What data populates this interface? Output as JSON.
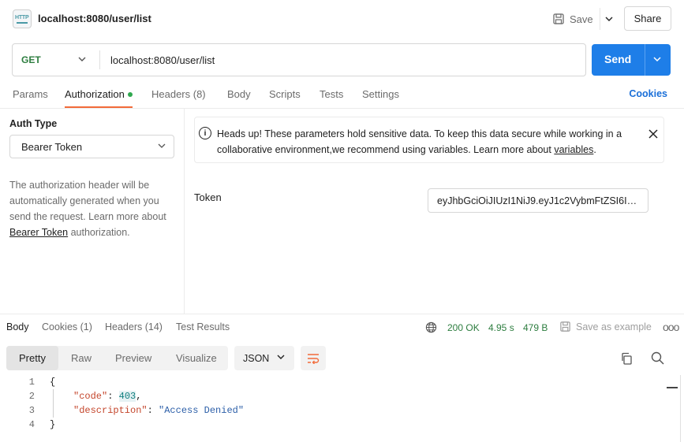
{
  "header": {
    "badge_text": "HTTP",
    "title": "localhost:8080/user/list",
    "save_label": "Save",
    "share_label": "Share"
  },
  "request": {
    "method": "GET",
    "url": "localhost:8080/user/list",
    "send_label": "Send"
  },
  "tabs": [
    {
      "label": "Params"
    },
    {
      "label": "Authorization",
      "active": true,
      "indicator": "green-dot"
    },
    {
      "label": "Headers (8)"
    },
    {
      "label": "Body"
    },
    {
      "label": "Scripts"
    },
    {
      "label": "Tests"
    },
    {
      "label": "Settings"
    }
  ],
  "cookies_label": "Cookies",
  "auth": {
    "type_label": "Auth Type",
    "type_value": "Bearer Token",
    "desc_prefix": "The authorization header will be automatically generated when you send the request. Learn more about ",
    "desc_link": "Bearer Token",
    "desc_suffix": " authorization.",
    "notice_prefix": "Heads up! These parameters hold sensitive data. To keep this data secure while working in a collaborative environment,we recommend using variables. Learn more about ",
    "notice_link": "variables",
    "notice_suffix": ".",
    "token_label": "Token",
    "token_value": "eyJhbGciOiJIUzI1NiJ9.eyJ1c2VybmFtZSI6In..."
  },
  "response": {
    "tabs": [
      {
        "label": "Body",
        "active": true
      },
      {
        "label": "Cookies (1)"
      },
      {
        "label": "Headers (14)"
      },
      {
        "label": "Test Results"
      }
    ],
    "status": "200 OK",
    "time": "4.95 s",
    "size": "479 B",
    "save_example_label": "Save as example",
    "more_label": "ooo",
    "formats": [
      {
        "label": "Pretty",
        "active": true
      },
      {
        "label": "Raw"
      },
      {
        "label": "Preview"
      },
      {
        "label": "Visualize"
      }
    ],
    "language": "JSON",
    "code_lines": [
      {
        "num": "1",
        "text": "{"
      },
      {
        "num": "2",
        "key": "\"code\"",
        "value": "403",
        "trail": ","
      },
      {
        "num": "3",
        "key": "\"description\"",
        "value": "\"Access Denied\"",
        "trail": ""
      },
      {
        "num": "4",
        "text": "}"
      }
    ]
  },
  "colors": {
    "accent": "#1e7ee8",
    "method_get": "#2d7d3f",
    "active_tab_underline": "#f26b3a",
    "status_ok": "#2d7d3f"
  }
}
